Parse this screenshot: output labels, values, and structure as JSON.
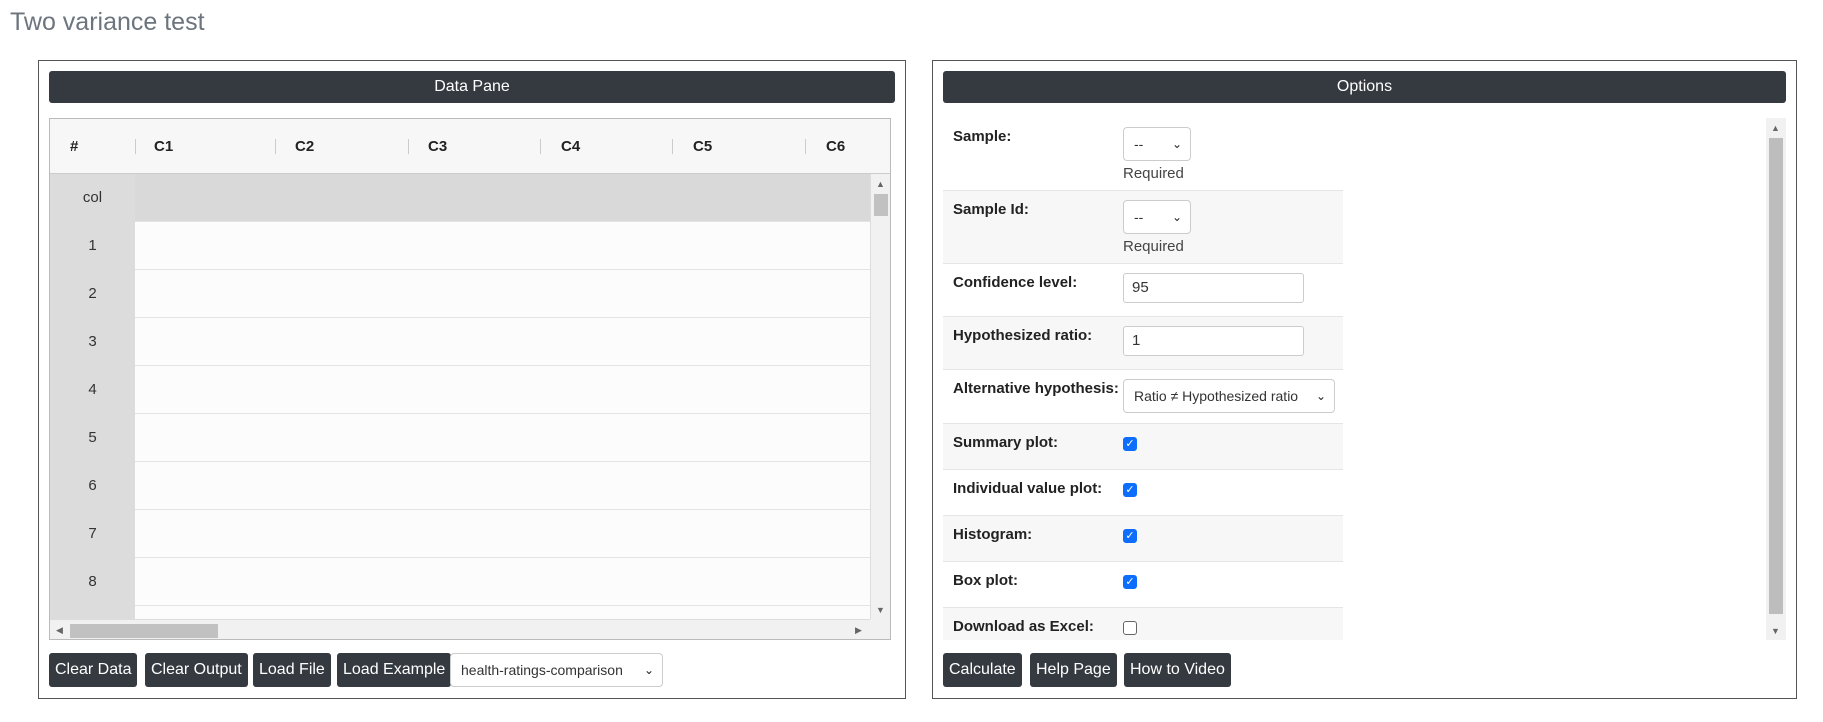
{
  "page": {
    "title": "Two variance test"
  },
  "data_pane": {
    "header": "Data Pane",
    "columns": [
      "#",
      "C1",
      "C2",
      "C3",
      "C4",
      "C5",
      "C6"
    ],
    "rows": [
      "col",
      "1",
      "2",
      "3",
      "4",
      "5",
      "6",
      "7",
      "8"
    ],
    "buttons": {
      "clear_data": "Clear Data",
      "clear_output": "Clear Output",
      "load_file": "Load File",
      "load_example": "Load Example"
    },
    "example_select": {
      "value": "health-ratings-comparison"
    }
  },
  "options": {
    "header": "Options",
    "sample": {
      "label": "Sample:",
      "value": "--",
      "hint": "Required"
    },
    "sample_id": {
      "label": "Sample Id:",
      "value": "--",
      "hint": "Required"
    },
    "confidence": {
      "label": "Confidence level:",
      "value": "95"
    },
    "hyp_ratio": {
      "label": "Hypothesized ratio:",
      "value": "1"
    },
    "alternative": {
      "label": "Alternative hypothesis:",
      "value": "Ratio ≠ Hypothesized ratio"
    },
    "summary_plot": {
      "label": "Summary plot:",
      "checked": true
    },
    "individual_plot": {
      "label": "Individual value plot:",
      "checked": true
    },
    "histogram": {
      "label": "Histogram:",
      "checked": true
    },
    "box_plot": {
      "label": "Box plot:",
      "checked": true
    },
    "download_excel": {
      "label": "Download as Excel:",
      "checked": false
    },
    "buttons": {
      "calculate": "Calculate",
      "help_page": "Help Page",
      "how_to_video": "How to Video"
    }
  },
  "colors": {
    "dark": "#343a40",
    "check": "#0d6efd"
  }
}
